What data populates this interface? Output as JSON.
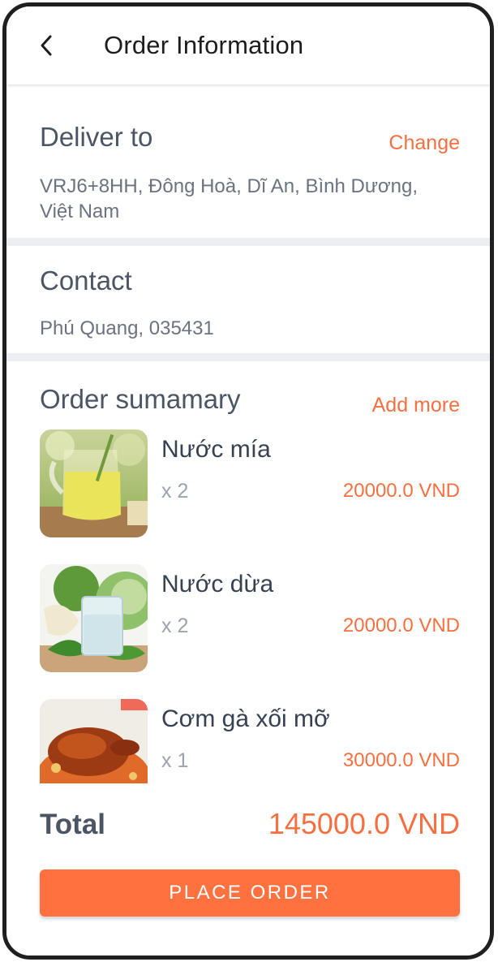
{
  "header": {
    "title": "Order Information"
  },
  "deliver": {
    "heading": "Deliver to",
    "change_label": "Change",
    "address_line1": "VRJ6+8HH, Đông Hoà, Dĩ An, Bình Dương,",
    "address_line2": "Việt Nam"
  },
  "contact": {
    "heading": "Contact",
    "info": "Phú Quang, 035431"
  },
  "summary": {
    "heading": "Order sumamary",
    "add_more_label": "Add more",
    "items": [
      {
        "name": "Nước mía",
        "qty": "x 2",
        "price": "20000.0 VND"
      },
      {
        "name": "Nước dừa",
        "qty": "x 2",
        "price": "20000.0 VND"
      },
      {
        "name": "Cơm gà xối mỡ",
        "qty": "x 1",
        "price": "30000.0 VND"
      }
    ]
  },
  "total": {
    "label": "Total",
    "value": "145000.0 VND"
  },
  "actions": {
    "place_order_label": "PLACE ORDER"
  },
  "colors": {
    "accent": "#ff7240",
    "heading": "#4b5563",
    "divider": "#eceef2"
  }
}
